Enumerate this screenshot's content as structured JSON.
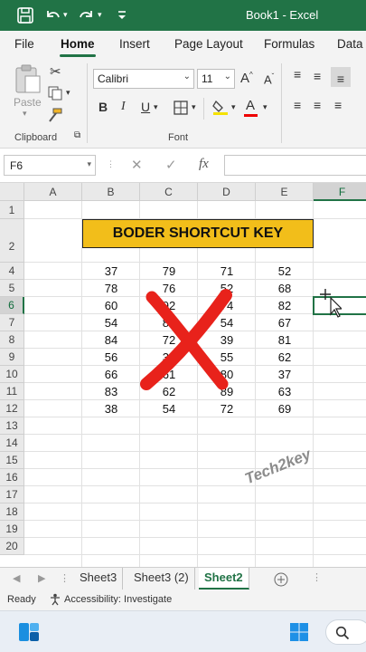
{
  "titlebar": {
    "title": "Book1  -  Excel"
  },
  "ribbon_tabs": [
    "File",
    "Home",
    "Insert",
    "Page Layout",
    "Formulas",
    "Data"
  ],
  "ribbon": {
    "paste_label": "Paste",
    "clipboard_label": "Clipboard",
    "font_label": "Font",
    "font_name": "Calibri",
    "font_size": "11",
    "bold": "B",
    "italic": "I",
    "underline": "U",
    "grow_font": "A",
    "shrink_font": "A"
  },
  "formula_bar": {
    "name_box": "F6",
    "fx": "fx",
    "value": ""
  },
  "columns": [
    "A",
    "B",
    "C",
    "D",
    "E",
    "F"
  ],
  "rows": [
    "1",
    "2",
    "4",
    "5",
    "6",
    "7",
    "8",
    "9",
    "10",
    "11",
    "12",
    "13",
    "14",
    "15",
    "16",
    "17",
    "18",
    "19",
    "20"
  ],
  "banner_text": "BODER SHORTCUT KEY",
  "table": [
    [
      "37",
      "79",
      "71",
      "52"
    ],
    [
      "78",
      "76",
      "52",
      "68"
    ],
    [
      "60",
      "92",
      "74",
      "82"
    ],
    [
      "54",
      "83",
      "54",
      "67"
    ],
    [
      "84",
      "72",
      "39",
      "81"
    ],
    [
      "56",
      "31",
      "55",
      "62"
    ],
    [
      "66",
      "61",
      "80",
      "37"
    ],
    [
      "83",
      "62",
      "89",
      "63"
    ],
    [
      "38",
      "54",
      "72",
      "69"
    ]
  ],
  "watermark": "Tech2key",
  "sheet_tabs": [
    "Sheet3",
    "Sheet3 (2)",
    "Sheet2"
  ],
  "active_sheet": "Sheet2",
  "status": {
    "ready": "Ready",
    "accessibility": "Accessibility: Investigate"
  },
  "colors": {
    "excel_green": "#217346",
    "banner_fill": "#f2be1a",
    "cross_red": "#e8221b"
  }
}
